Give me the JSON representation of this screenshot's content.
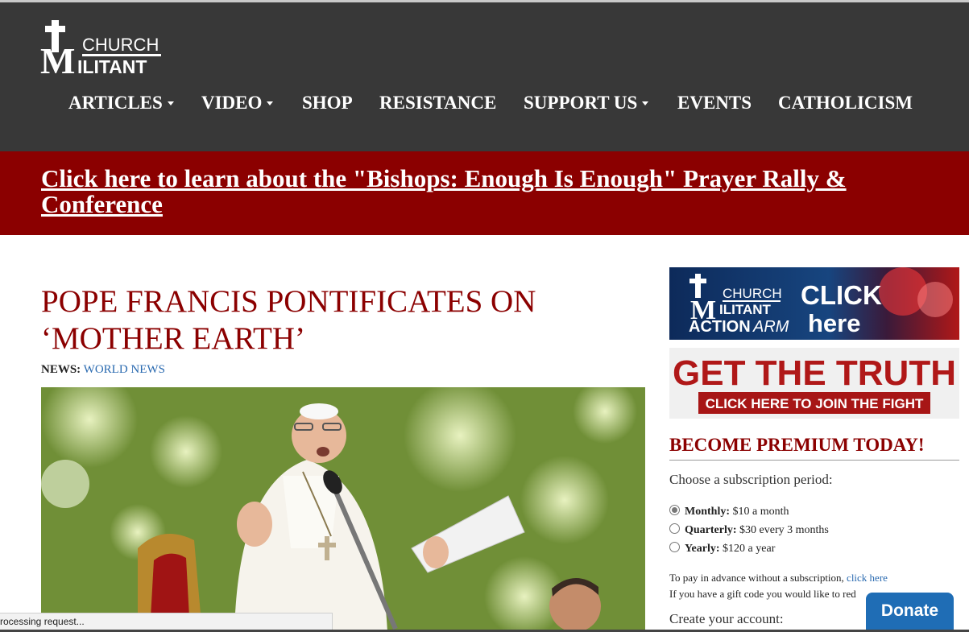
{
  "logo": {
    "top_text": "CHURCH",
    "bottom_text": "ILITANT",
    "big_letter": "M"
  },
  "nav": {
    "items": [
      {
        "label": "ARTICLES",
        "dropdown": true
      },
      {
        "label": "VIDEO",
        "dropdown": true
      },
      {
        "label": "SHOP",
        "dropdown": false
      },
      {
        "label": "RESISTANCE",
        "dropdown": false
      },
      {
        "label": "SUPPORT US",
        "dropdown": true
      },
      {
        "label": "EVENTS",
        "dropdown": false
      },
      {
        "label": "CATHOLICISM",
        "dropdown": false
      }
    ]
  },
  "banner": {
    "link_text": "Click here to learn about the \"Bishops: Enough Is Enough\" Prayer Rally & Conference"
  },
  "article": {
    "title": "POPE FRANCIS PONTIFICATES ON ‘MOTHER EARTH’",
    "category_label": "NEWS:",
    "category_link": "WORLD NEWS"
  },
  "sidebar": {
    "ad1": {
      "logo_top": "CHURCH",
      "logo_bottom": "ILITANT",
      "logo_line": "ACTION",
      "logo_arm": "ARM",
      "cta_1": "CLICK",
      "cta_2": "here"
    },
    "ad2": {
      "headline": "GET THE TRUTH",
      "button": "CLICK HERE TO JOIN THE FIGHT"
    },
    "premium": {
      "title": "BECOME PREMIUM TODAY!",
      "period_label": "Choose a subscription period:",
      "options": [
        {
          "name": "Monthly:",
          "price": "$10 a month",
          "checked": true
        },
        {
          "name": "Quarterly:",
          "price": "$30 every 3 months",
          "checked": false
        },
        {
          "name": "Yearly:",
          "price": "$120 a year",
          "checked": false
        }
      ],
      "advance_text": "To pay in advance without a subscription, ",
      "advance_link": "click here",
      "gift_text": "If you have a gift code you would like to red",
      "create_account": "Create your account:"
    }
  },
  "donate_label": "Donate",
  "status_text": "rocessing request...",
  "colors": {
    "header_bg": "#383838",
    "brand_red": "#8b0000",
    "link_blue": "#2a6ab0",
    "donate_blue": "#1f6db5"
  }
}
